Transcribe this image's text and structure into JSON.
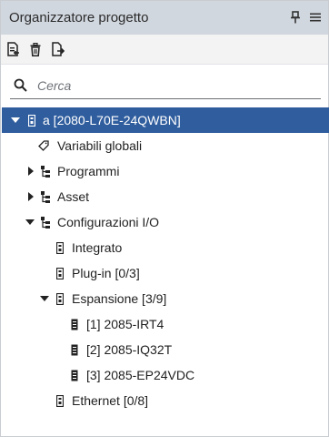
{
  "panel": {
    "title": "Organizzatore progetto",
    "pin_icon": "pin-icon",
    "menu_icon": "hamburger-menu-icon"
  },
  "toolbar": {
    "tools": [
      "new-item-icon",
      "delete-icon",
      "export-icon"
    ]
  },
  "search": {
    "placeholder": "Cerca",
    "icon": "search-icon"
  },
  "tree": {
    "root": {
      "label": "a [2080-L70E-24QWBN]",
      "expanded": true,
      "selected": true,
      "icon": "controller-icon"
    },
    "items": [
      {
        "label": "Variabili globali",
        "icon": "tag-icon"
      },
      {
        "label": "Programmi",
        "icon": "hierarchy-icon",
        "expanded": false
      },
      {
        "label": "Asset",
        "icon": "hierarchy-icon",
        "expanded": false
      },
      {
        "label": "Configurazioni I/O",
        "icon": "hierarchy-icon",
        "expanded": true
      },
      {
        "label": "Integrato",
        "icon": "module-icon"
      },
      {
        "label": "Plug-in [0/3]",
        "icon": "module-icon"
      },
      {
        "label": "Espansione [3/9]",
        "icon": "module-icon",
        "expanded": true
      },
      {
        "label": "[1] 2085-IRT4",
        "icon": "io-module-icon"
      },
      {
        "label": "[2] 2085-IQ32T",
        "icon": "io-module-icon"
      },
      {
        "label": "[3] 2085-EP24VDC",
        "icon": "io-module-icon"
      },
      {
        "label": "Ethernet [0/8]",
        "icon": "module-icon"
      }
    ]
  },
  "colors": {
    "titlebar_bg": "#d1d7df",
    "selected_bg": "#2f5d9e",
    "selected_fg": "#ffffff"
  }
}
